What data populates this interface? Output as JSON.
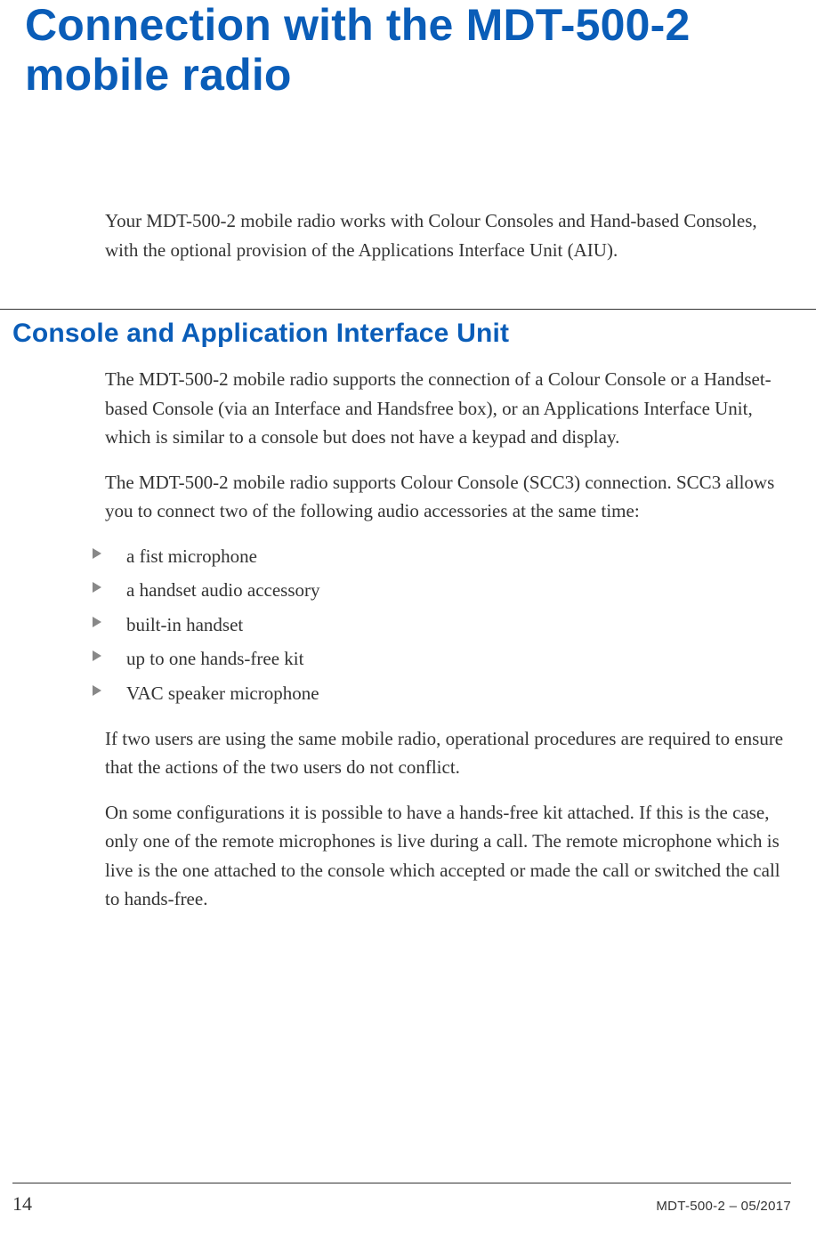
{
  "title": "Connection with the MDT-500-2 mobile radio",
  "intro": "Your MDT-500-2 mobile radio works with Colour Consoles and Hand-based Consoles, with the optional provision of the Applications Interface Unit (AIU).",
  "section": {
    "heading": "Console and Application Interface Unit",
    "p1": "The MDT-500-2 mobile radio supports the connection of a Colour Console or a Handset-based Console (via an Interface and Handsfree box), or an Applications Interface Unit, which is similar to a console but does not have a keypad and display.",
    "p2": "The MDT-500-2 mobile radio supports Colour Console (SCC3) connection. SCC3 allows you to connect two of the following audio accessories at the same time:",
    "bullets": [
      "a fist microphone",
      "a handset audio accessory",
      "built-in handset",
      "up to one hands-free kit",
      "VAC speaker microphone"
    ],
    "p3": "If two users are using the same mobile radio, operational procedures are required to ensure that the actions of the two users do not conflict.",
    "p4": "On some configurations it is possible to have a hands-free kit attached. If this is the case, only one of the remote microphones is live during a call. The remote microphone which is live is the one attached to the console which accepted or made the call or switched the call to hands-free."
  },
  "footer": {
    "page": "14",
    "docid": "MDT-500-2 – 05/2017"
  }
}
